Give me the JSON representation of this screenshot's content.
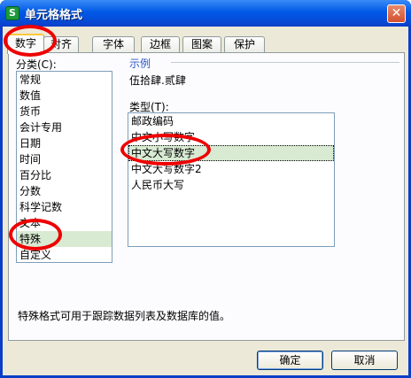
{
  "window": {
    "title": "单元格格式",
    "app_icon_letter": "S",
    "close_glyph": "✕"
  },
  "tabs": [
    {
      "label": "数字",
      "active": true
    },
    {
      "label": "对齐",
      "active": false
    },
    {
      "label": "字体",
      "active": false
    },
    {
      "label": "边框",
      "active": false
    },
    {
      "label": "图案",
      "active": false
    },
    {
      "label": "保护",
      "active": false
    }
  ],
  "category": {
    "label": "分类(C):",
    "items": [
      "常规",
      "数值",
      "货币",
      "会计专用",
      "日期",
      "时间",
      "百分比",
      "分数",
      "科学记数",
      "文本",
      "特殊",
      "自定义"
    ],
    "selected": "特殊"
  },
  "sample": {
    "title": "示例",
    "value": "伍拾肆.贰肆"
  },
  "type": {
    "label": "类型(T):",
    "items": [
      "邮政编码",
      "中文小写数字",
      "中文大写数字",
      "中文大写数字2",
      "人民币大写"
    ],
    "selected": "中文大写数字"
  },
  "description": "特殊格式可用于跟踪数据列表及数据库的值。",
  "buttons": {
    "ok": "确定",
    "cancel": "取消"
  },
  "colors": {
    "title_bar": "#0058e6",
    "selection": "#d9ead3",
    "annotation": "#ee0000",
    "sample_title": "#2a56c6"
  }
}
